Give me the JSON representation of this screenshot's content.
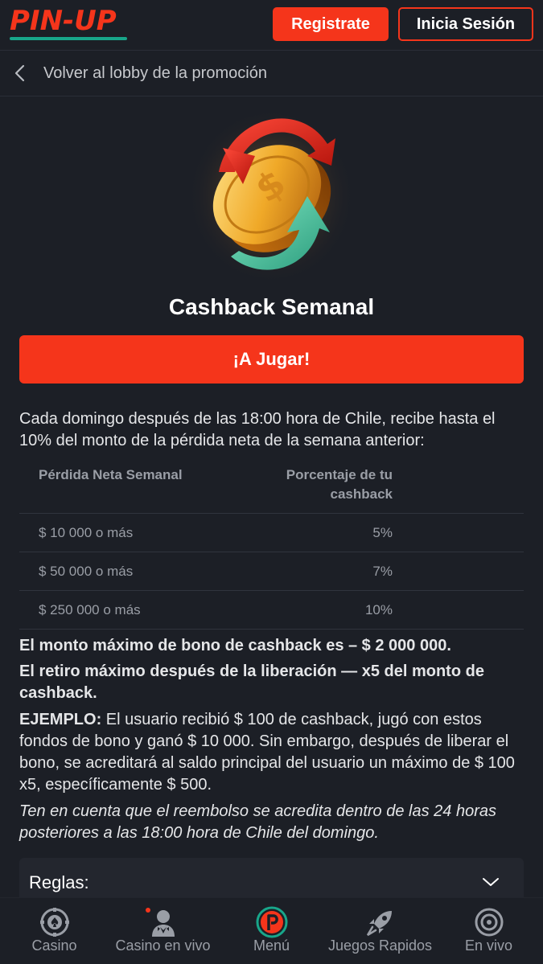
{
  "header": {
    "logo": "PIN-UP",
    "register_label": "Registrate",
    "login_label": "Inicia Sesión",
    "brand_color": "#f5351b",
    "accent_color": "#18a68a"
  },
  "backbar": {
    "icon": "chevron-left-icon",
    "label": "Volver al lobby de la promoción"
  },
  "promo": {
    "title": "Cashback Semanal",
    "play_label": "¡A Jugar!",
    "intro": "Cada domingo después de las 18:00 hora de Chile, recibe hasta el 10% del monto de la pérdida neta de la semana anterior:"
  },
  "table": {
    "headers": [
      "Pérdida Neta Semanal",
      "Porcentaje de tu cashback"
    ],
    "rows": [
      [
        "$ 10 000 o más",
        "5%"
      ],
      [
        "$ 50 000 o más",
        "7%"
      ],
      [
        "$ 250 000 o más",
        "10%"
      ]
    ]
  },
  "notes": {
    "max_bonus": "El monto máximo de bono de cashback es – $ 2 000 000.",
    "max_withdrawal": "El retiro máximo después de la liberación — x5 del monto de cashback.",
    "example_label": "EJEMPLO:",
    "example_text": " El usuario recibió $ 100 de cashback, jugó con estos fondos de bono y ganó $ 10 000. Sin embargo, después de liberar el bono, se acreditará al saldo principal del usuario un máximo de $ 100 x5, específicamente $ 500.",
    "disclaimer": "Ten en cuenta que el reembolso se acredita dentro de las 24 horas posteriores a las 18:00 hora de Chile del domingo."
  },
  "rules": {
    "label": "Reglas:",
    "icon": "chevron-down-icon"
  },
  "bottom_nav": {
    "items": [
      {
        "label": "Casino",
        "icon": "poker-chip-icon"
      },
      {
        "label": "Casino en vivo",
        "icon": "dealer-icon"
      },
      {
        "label": "Menú",
        "icon": "pinup-menu-icon"
      },
      {
        "label": "Juegos Rapidos",
        "icon": "rocket-icon"
      },
      {
        "label": "En vivo",
        "icon": "live-target-icon"
      }
    ]
  }
}
